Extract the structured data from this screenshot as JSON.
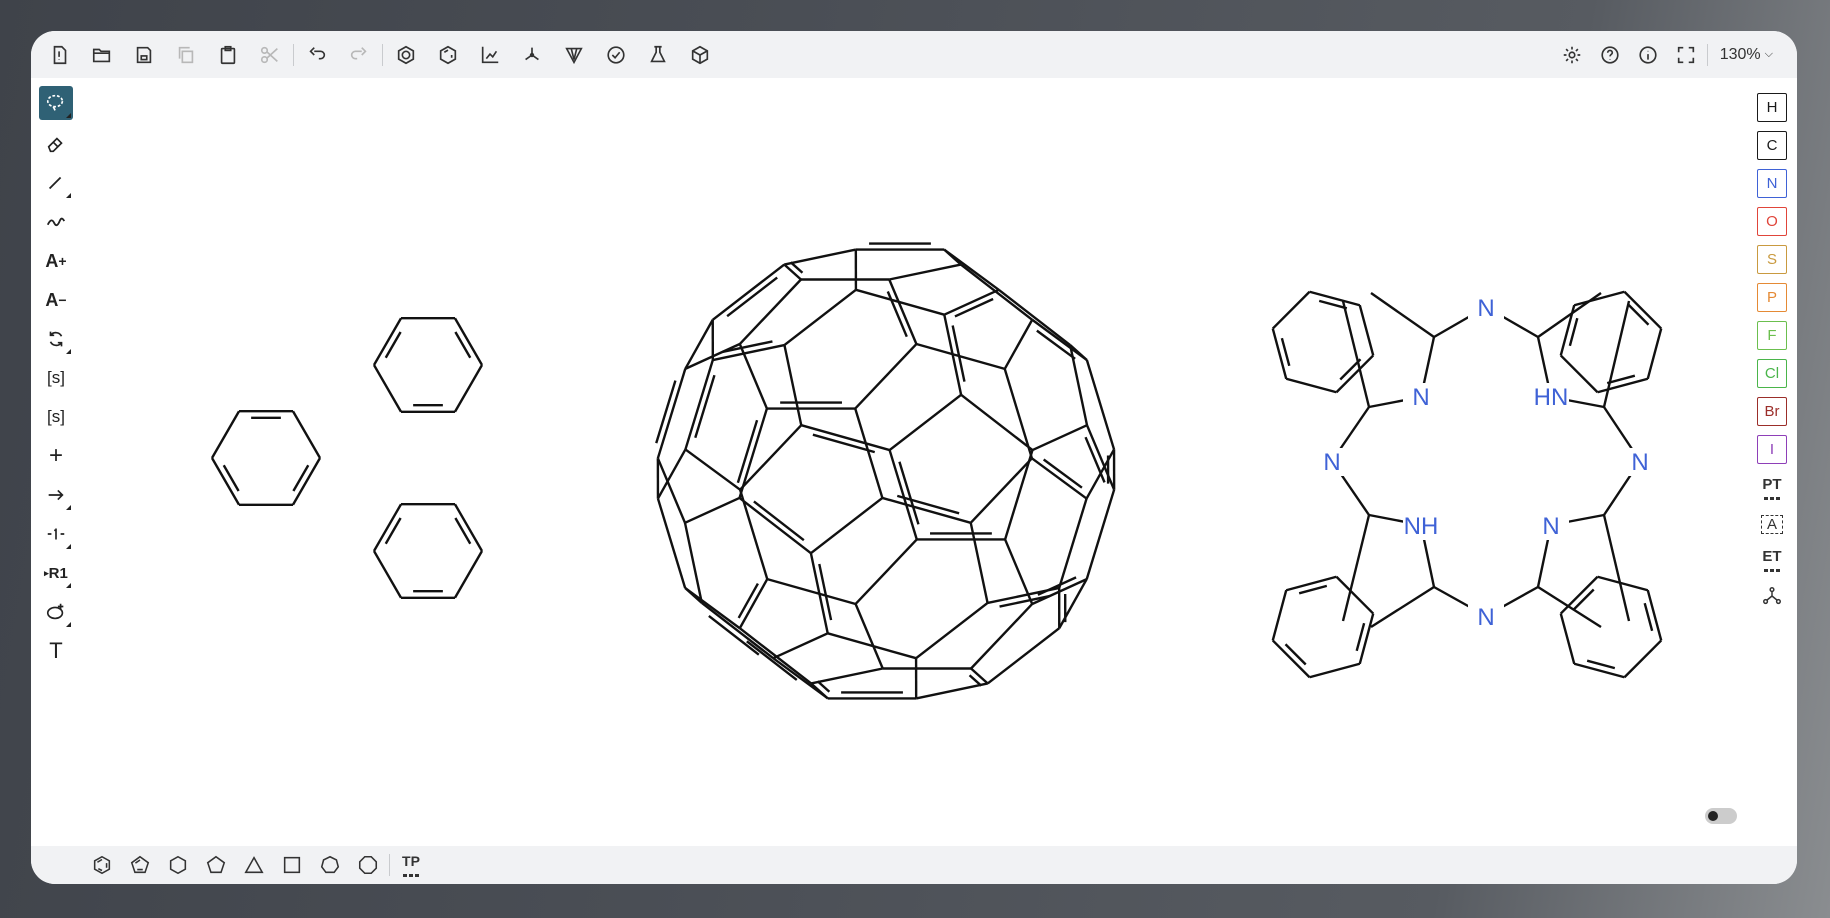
{
  "toolbar": {
    "zoom": "130%"
  },
  "left_tools": {
    "charge_plus": "A",
    "charge_plus_sup": "+",
    "charge_minus": "A",
    "charge_minus_sup": "−",
    "sgroup": "[s]",
    "sgroup_data": "[s]",
    "plus": "+",
    "rgroup": "R1",
    "text_tool": "T"
  },
  "elements": [
    {
      "symbol": "H",
      "color": "#1a1a1a"
    },
    {
      "symbol": "C",
      "color": "#1a1a1a"
    },
    {
      "symbol": "N",
      "color": "#3f62d6"
    },
    {
      "symbol": "O",
      "color": "#e0453a"
    },
    {
      "symbol": "S",
      "color": "#c99a40"
    },
    {
      "symbol": "P",
      "color": "#e58a35"
    },
    {
      "symbol": "F",
      "color": "#6bbf4e"
    },
    {
      "symbol": "Cl",
      "color": "#4ab54a"
    },
    {
      "symbol": "Br",
      "color": "#9b2e2a"
    },
    {
      "symbol": "I",
      "color": "#8e3fb8"
    }
  ],
  "right_tools": {
    "periodic_table": "PT",
    "any_atom": "A",
    "extended_table": "ET"
  },
  "bottom_tools": {
    "template_library": "TP"
  },
  "molecules": {
    "phthalocyanine_atoms": [
      "N",
      "N",
      "HN",
      "N",
      "N",
      "NH",
      "N",
      "N"
    ]
  }
}
